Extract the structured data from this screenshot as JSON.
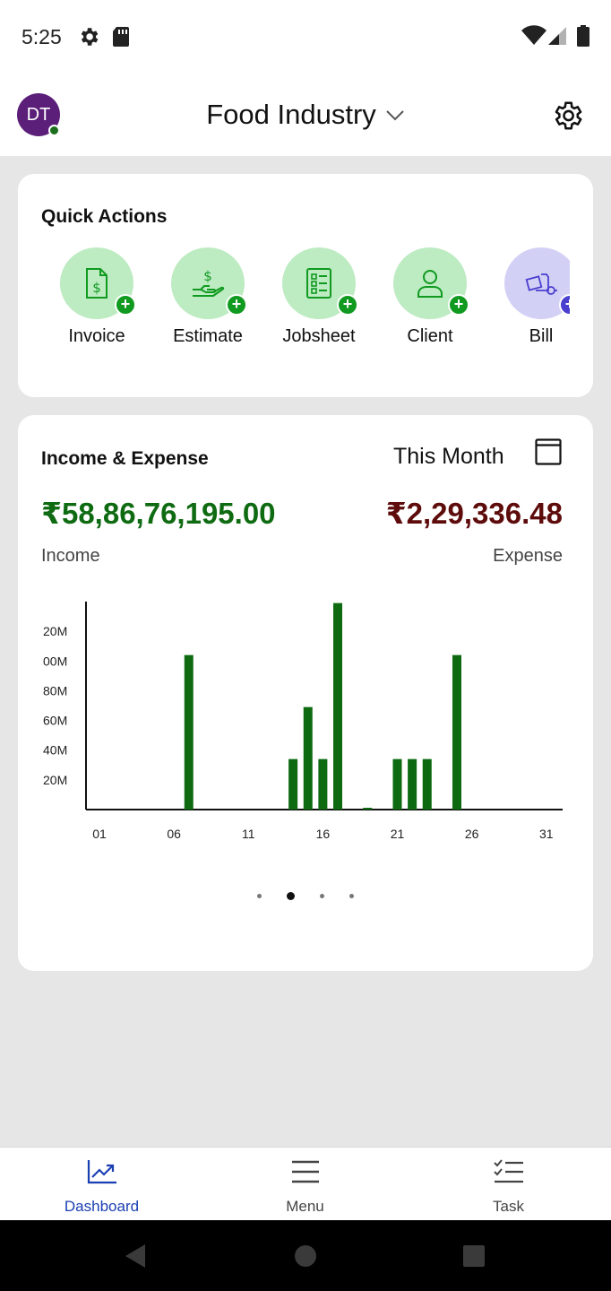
{
  "status_bar": {
    "time": "5:25",
    "icons": [
      "gear-icon",
      "sdcard-icon",
      "wifi-icon",
      "signal-icon",
      "battery-icon"
    ]
  },
  "header": {
    "avatar_initials": "DT",
    "title": "Food Industry",
    "icons": [
      "chevron-down-icon",
      "settings-gear-icon"
    ]
  },
  "quick_actions": {
    "title": "Quick Actions",
    "items": [
      {
        "label": "Invoice",
        "icon": "invoice-icon"
      },
      {
        "label": "Estimate",
        "icon": "estimate-icon"
      },
      {
        "label": "Jobsheet",
        "icon": "jobsheet-icon"
      },
      {
        "label": "Client",
        "icon": "client-icon"
      },
      {
        "label": "Bill",
        "icon": "bill-icon"
      }
    ]
  },
  "income_expense": {
    "title": "Income & Expense",
    "period": "This Month",
    "income_value": "₹58,86,76,195.00",
    "expense_value": "₹2,29,336.48",
    "income_label": "Income",
    "expense_label": "Expense",
    "page_count": 4,
    "active_page": 2
  },
  "chart_data": {
    "type": "bar",
    "title": "",
    "xlabel": "",
    "ylabel": "",
    "x_ticks": [
      "01",
      "06",
      "11",
      "16",
      "21",
      "26",
      "31"
    ],
    "y_ticks": [
      "20M",
      "40M",
      "60M",
      "80M",
      "00M",
      "20M"
    ],
    "ylim": [
      0,
      140
    ],
    "series": [
      {
        "color": "#0d6a10",
        "days": [
          7,
          14,
          15,
          16,
          17,
          21,
          22,
          23,
          25
        ],
        "values": [
          104,
          34,
          69,
          34,
          139,
          34,
          34,
          34,
          104
        ]
      }
    ]
  },
  "bottom_nav": {
    "items": [
      {
        "label": "Dashboard",
        "icon": "dashboard-icon",
        "active": true
      },
      {
        "label": "Menu",
        "icon": "menu-icon",
        "active": false
      },
      {
        "label": "Task",
        "icon": "task-icon",
        "active": false
      }
    ]
  },
  "colors": {
    "accent_green": "#0f6b12",
    "expense_red": "#5e0b0b",
    "nav_active": "#1a3fb3",
    "avatar": "#5b1f7a"
  }
}
